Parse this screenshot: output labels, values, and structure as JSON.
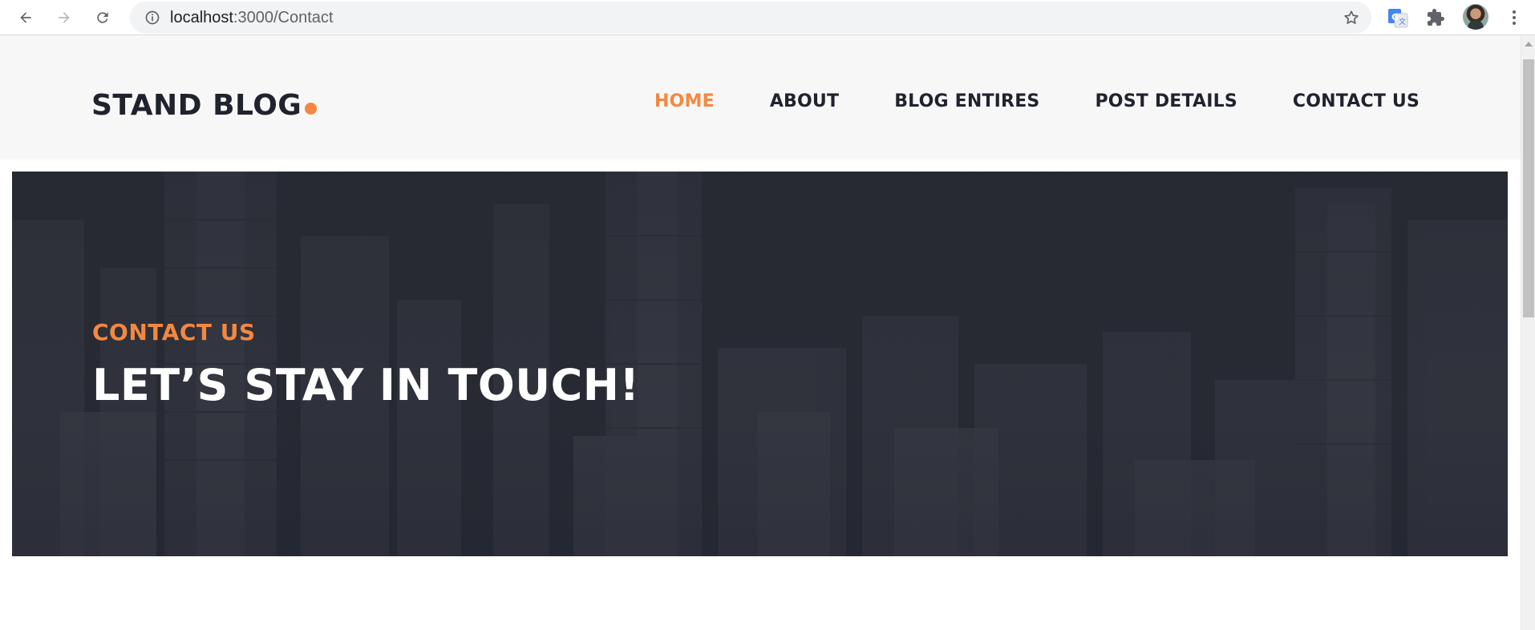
{
  "browser": {
    "url_host": "localhost",
    "url_path": ":3000/Contact"
  },
  "site": {
    "logo": "STAND BLOG",
    "accent_color": "#f48840",
    "dark_color": "#20232e"
  },
  "nav": {
    "items": [
      {
        "label": "HOME",
        "active": true
      },
      {
        "label": "ABOUT",
        "active": false
      },
      {
        "label": "BLOG ENTIRES",
        "active": false
      },
      {
        "label": "POST DETAILS",
        "active": false
      },
      {
        "label": "CONTACT US",
        "active": false
      }
    ]
  },
  "hero": {
    "label": "CONTACT US",
    "title": "LET’S STAY IN TOUCH!"
  }
}
